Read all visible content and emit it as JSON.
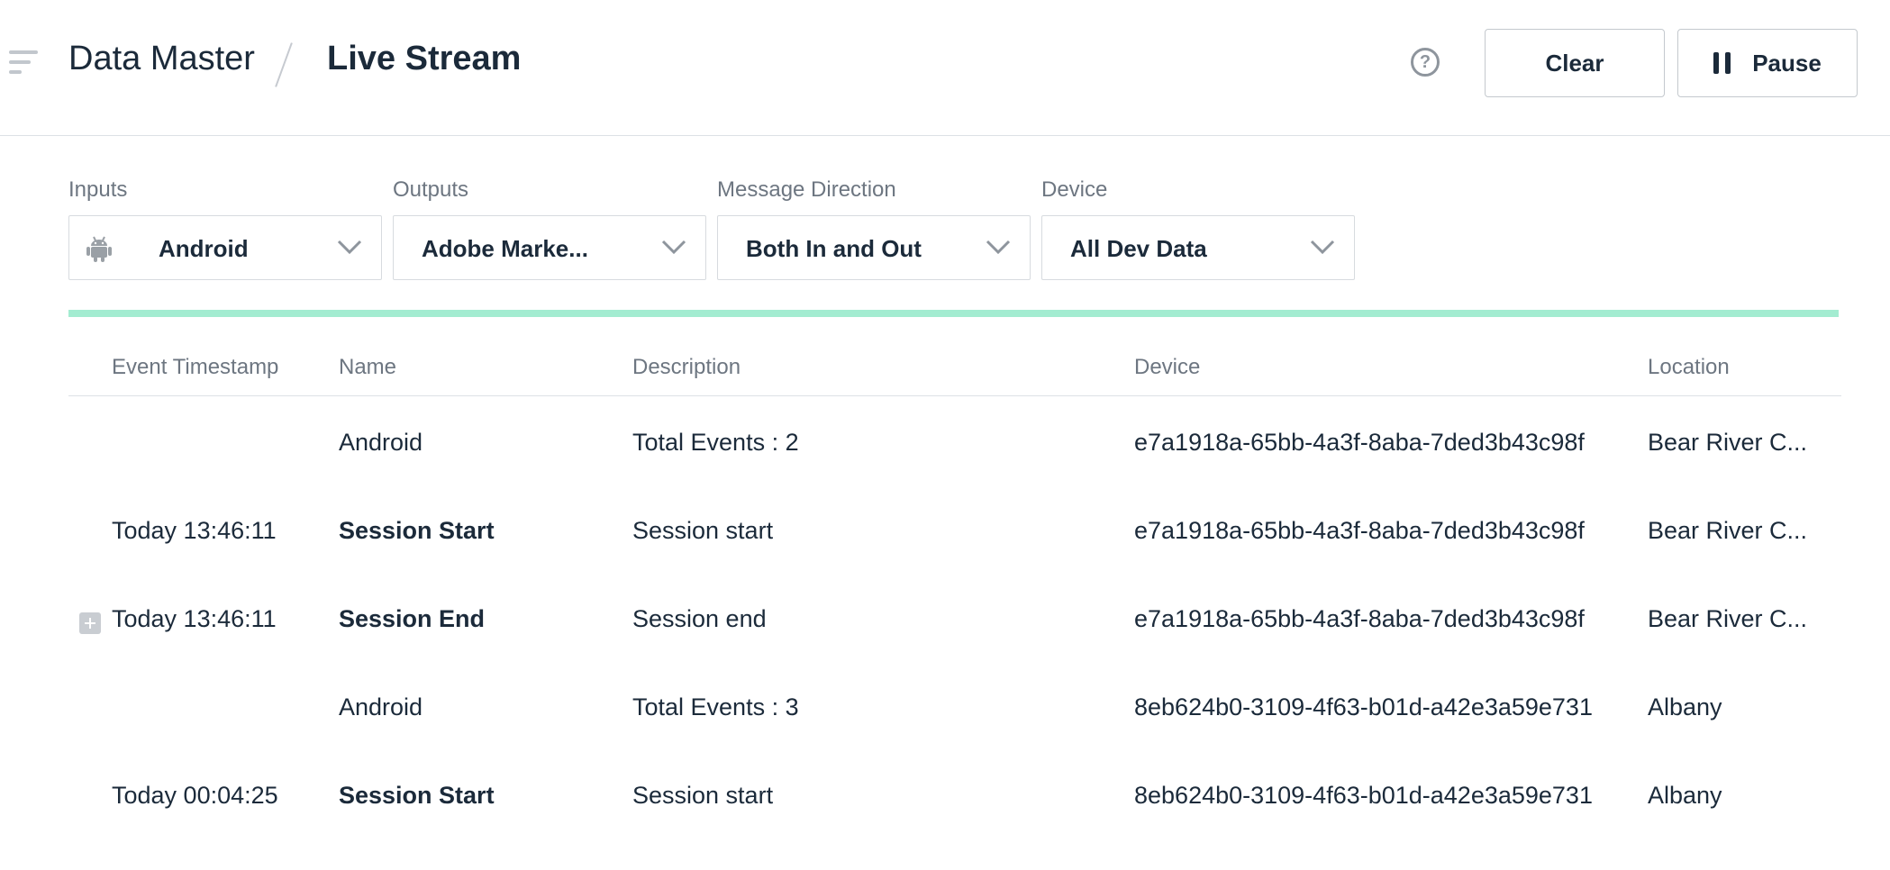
{
  "header": {
    "breadcrumb_parent": "Data Master",
    "breadcrumb_current": "Live Stream",
    "clear_label": "Clear",
    "pause_label": "Pause"
  },
  "filters": {
    "inputs": {
      "label": "Inputs",
      "value": "Android",
      "icon": "android-icon"
    },
    "outputs": {
      "label": "Outputs",
      "value": "Adobe Marke..."
    },
    "message_direction": {
      "label": "Message Direction",
      "value": "Both In and Out"
    },
    "device": {
      "label": "Device",
      "value": "All Dev Data"
    }
  },
  "stream_progress": {
    "fraction": 1.0,
    "color": "#a3ecd1"
  },
  "table": {
    "columns": [
      "Event Timestamp",
      "Name",
      "Description",
      "Device",
      "Location"
    ],
    "rows": [
      {
        "timestamp": "",
        "name": "Android",
        "name_bold": false,
        "description": "Total Events : 2",
        "device": "e7a1918a-65bb-4a3f-8aba-7ded3b43c98f",
        "location": "Bear River C...",
        "expandable": false
      },
      {
        "timestamp": "Today 13:46:11",
        "name": "Session Start",
        "name_bold": true,
        "description": "Session start",
        "device": "e7a1918a-65bb-4a3f-8aba-7ded3b43c98f",
        "location": "Bear River C...",
        "expandable": false
      },
      {
        "timestamp": "Today 13:46:11",
        "name": "Session End",
        "name_bold": true,
        "description": "Session end",
        "device": "e7a1918a-65bb-4a3f-8aba-7ded3b43c98f",
        "location": "Bear River C...",
        "expandable": true
      },
      {
        "timestamp": "",
        "name": "Android",
        "name_bold": false,
        "description": "Total Events : 3",
        "device": "8eb624b0-3109-4f63-b01d-a42e3a59e731",
        "location": "Albany",
        "expandable": false
      },
      {
        "timestamp": "Today 00:04:25",
        "name": "Session Start",
        "name_bold": true,
        "description": "Session start",
        "device": "8eb624b0-3109-4f63-b01d-a42e3a59e731",
        "location": "Albany",
        "expandable": false
      }
    ]
  },
  "colors": {
    "text": "#1b2a3a",
    "muted": "#6d7681",
    "accent": "#a3ecd1"
  }
}
